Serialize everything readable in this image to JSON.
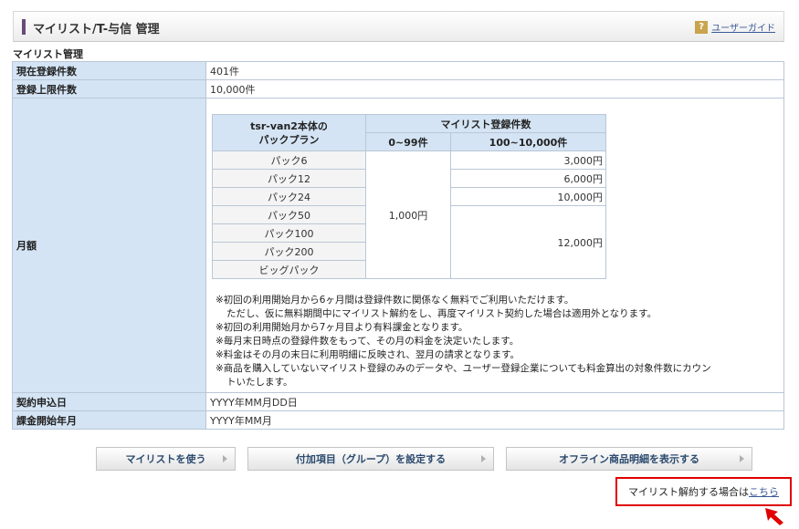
{
  "header": {
    "title": "マイリスト/T-与信 管理",
    "guide_icon": "?",
    "guide_label": "ユーザーガイド"
  },
  "section_title": "マイリスト管理",
  "rows": {
    "registered_count": {
      "label": "現在登録件数",
      "value": "401件"
    },
    "max_count": {
      "label": "登録上限件数",
      "value": "10,000件"
    },
    "monthly": {
      "label": "月額"
    },
    "contract_date": {
      "label": "契約申込日",
      "value": "YYYY年MM月DD日"
    },
    "billing_start": {
      "label": "課金開始年月",
      "value": "YYYY年MM月"
    }
  },
  "price_table": {
    "plan_header": "tsr-van2本体の\nパックプラン",
    "group_header": "マイリスト登録件数",
    "col1_header": "0~99件",
    "col2_header": "100~10,000件",
    "plans": [
      "パック6",
      "パック12",
      "パック24",
      "パック50",
      "パック100",
      "パック200",
      "ビッグパック"
    ],
    "col1_value": "1,000円",
    "col2_values": [
      "3,000円",
      "6,000円",
      "10,000円",
      "12,000円"
    ]
  },
  "notes": [
    "※初回の利用開始月から6ヶ月間は登録件数に関係なく無料でご利用いただけます。",
    "ただし、仮に無料期間中にマイリスト解約をし、再度マイリスト契約した場合は適用外となります。",
    "※初回の利用開始月から7ヶ月目より有料課金となります。",
    "※毎月末日時点の登録件数をもって、その月の料金を決定いたします。",
    "※料金はその月の末日に利用明細に反映され、翌月の請求となります。",
    "※商品を購入していないマイリスト登録のみのデータや、ユーザー登録企業についても料金算出の対象件数にカウン",
    "トいたします。"
  ],
  "buttons": {
    "use_mylist": "マイリストを使う",
    "set_group": "付加項目（グループ）を設定する",
    "offline": "オフライン商品明細を表示する"
  },
  "cancel": {
    "text": "マイリスト解約する場合は",
    "link": "こちら"
  },
  "colors": {
    "label_bg": "#d4e4f4",
    "accent_bar": "#6a4a7a",
    "highlight_red": "#e00000",
    "link": "#3b5998"
  }
}
